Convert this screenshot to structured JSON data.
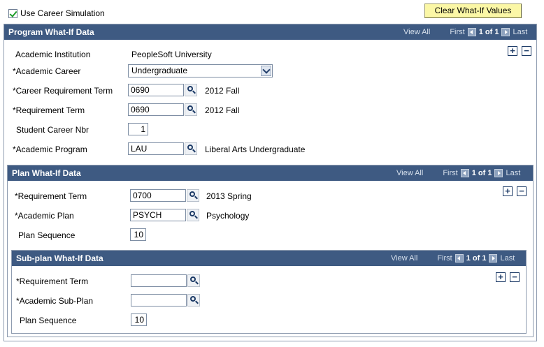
{
  "top": {
    "career_sim_label": "Use Career Simulation",
    "career_sim_checked": true,
    "clear_button": "Clear What-If Values"
  },
  "program": {
    "title": "Program What-If Data",
    "view_all": "View All",
    "first": "First",
    "counter": "1 of 1",
    "last": "Last",
    "add": "+",
    "remove": "−",
    "institution_label": "Academic Institution",
    "institution_value": "PeopleSoft University",
    "career_label": "*Academic Career",
    "career_value": "Undergraduate",
    "career_req_term_label": "*Career Requirement Term",
    "career_req_term_value": "0690",
    "career_req_term_desc": "2012 Fall",
    "req_term_label": "*Requirement Term",
    "req_term_value": "0690",
    "req_term_desc": "2012 Fall",
    "career_nbr_label": "Student Career Nbr",
    "career_nbr_value": "1",
    "program_label": "*Academic Program",
    "program_value": "LAU",
    "program_desc": "Liberal Arts Undergraduate"
  },
  "plan": {
    "title": "Plan What-If Data",
    "view_all": "View All",
    "first": "First",
    "counter": "1 of 1",
    "last": "Last",
    "add": "+",
    "remove": "−",
    "req_term_label": "*Requirement Term",
    "req_term_value": "0700",
    "req_term_desc": "2013 Spring",
    "plan_label": "*Academic Plan",
    "plan_value": "PSYCH",
    "plan_desc": "Psychology",
    "seq_label": "Plan Sequence",
    "seq_value": "10"
  },
  "subplan": {
    "title": "Sub-plan What-If Data",
    "view_all": "View All",
    "first": "First",
    "counter": "1 of 1",
    "last": "Last",
    "add": "+",
    "remove": "−",
    "req_term_label": "*Requirement Term",
    "req_term_value": "",
    "subplan_label": "*Academic Sub-Plan",
    "subplan_value": "",
    "seq_label": "Plan Sequence",
    "seq_value": "10"
  },
  "colors": {
    "header_bg": "#3e5a82",
    "button_bg": "#fbf7a6"
  }
}
